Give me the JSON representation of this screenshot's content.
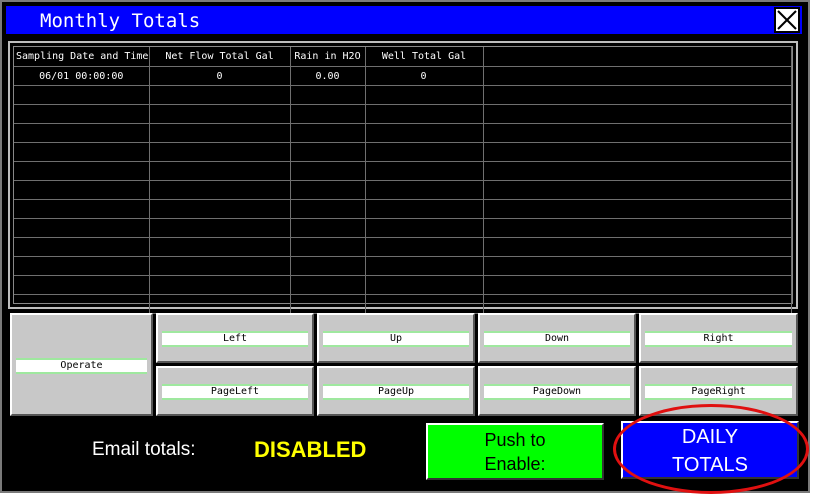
{
  "window": {
    "title": "Monthly Totals",
    "close_icon": "close-x-icon"
  },
  "table": {
    "columns": [
      "Sampling Date and Time",
      "Net Flow Total Gal",
      "Rain in H2O",
      "Well Total Gal",
      ""
    ],
    "rows": [
      [
        "06/01 00:00:00",
        "0",
        "0.00",
        "0",
        ""
      ]
    ],
    "empty_rows": 12
  },
  "nav": {
    "operate": "Operate",
    "left": "Left",
    "up": "Up",
    "down": "Down",
    "right": "Right",
    "page_left": "PageLeft",
    "page_up": "PageUp",
    "page_down": "PageDown",
    "page_right": "PageRight"
  },
  "email": {
    "label": "Email totals:",
    "status": "DISABLED",
    "status_color": "#ffff00"
  },
  "push_enable": {
    "line1": "Push to",
    "line2": "Enable:",
    "color": "#00ff00"
  },
  "daily_totals": {
    "line1": "DAILY",
    "line2": "TOTALS",
    "color": "#0000ff"
  },
  "highlight_color": "#e01010"
}
